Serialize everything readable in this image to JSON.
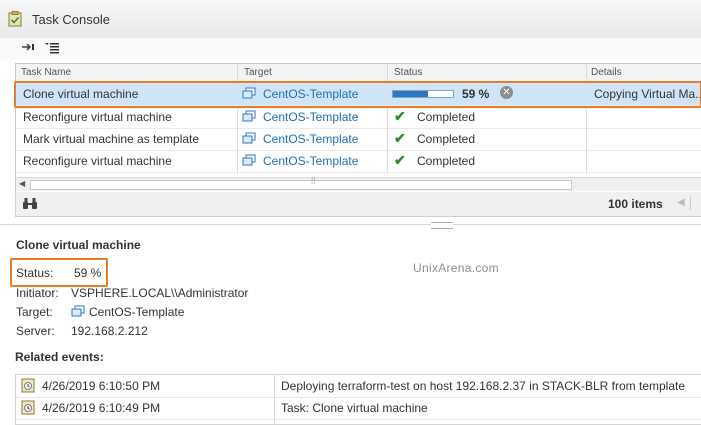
{
  "window": {
    "title": "Task Console",
    "title_icon": "task-console-icon"
  },
  "toolbar": {
    "buttons": [
      "collapse-arrow-icon",
      "column-filter-icon"
    ]
  },
  "grid": {
    "columns": [
      "Task Name",
      "Target",
      "Status",
      "Details"
    ],
    "rows": [
      {
        "task": "Clone virtual machine",
        "target": "CentOS-Template",
        "status": "59 %",
        "progress": 0.59,
        "details": "Copying Virtual Ma...",
        "selected": true
      },
      {
        "task": "Reconfigure virtual machine",
        "target": "CentOS-Template",
        "status": "Completed",
        "details": ""
      },
      {
        "task": "Mark virtual machine as template",
        "target": "CentOS-Template",
        "status": "Completed",
        "details": ""
      },
      {
        "task": "Reconfigure virtual machine",
        "target": "CentOS-Template",
        "status": "Completed",
        "details": ""
      }
    ],
    "count": "100 items"
  },
  "detail": {
    "title": "Clone virtual machine",
    "status_label": "Status:",
    "status_value": "59 %",
    "initiator_label": "Initiator:",
    "initiator_value": "VSPHERE.LOCAL\\\\Administrator",
    "target_label": "Target:",
    "target_value": "CentOS-Template",
    "server_label": "Server:",
    "server_value": "192.168.2.212"
  },
  "watermark": "UnixArena.com",
  "related": {
    "heading": "Related events:",
    "events": [
      {
        "time": "4/26/2019 6:10:50 PM",
        "pre": "Deploying ",
        "name": "terraform-test",
        "mid": " on host ",
        "host": "192.168.2.37",
        "in": " in ",
        "dc": "STACK-BLR",
        "post": " from template"
      },
      {
        "time": "4/26/2019 6:10:49 PM",
        "text": "Task: Clone virtual machine"
      }
    ]
  },
  "colors": {
    "accent": "#e87d27",
    "link": "#1f6fb2",
    "selected_row": "#cfe5f7",
    "check": "#2e8b2e"
  }
}
